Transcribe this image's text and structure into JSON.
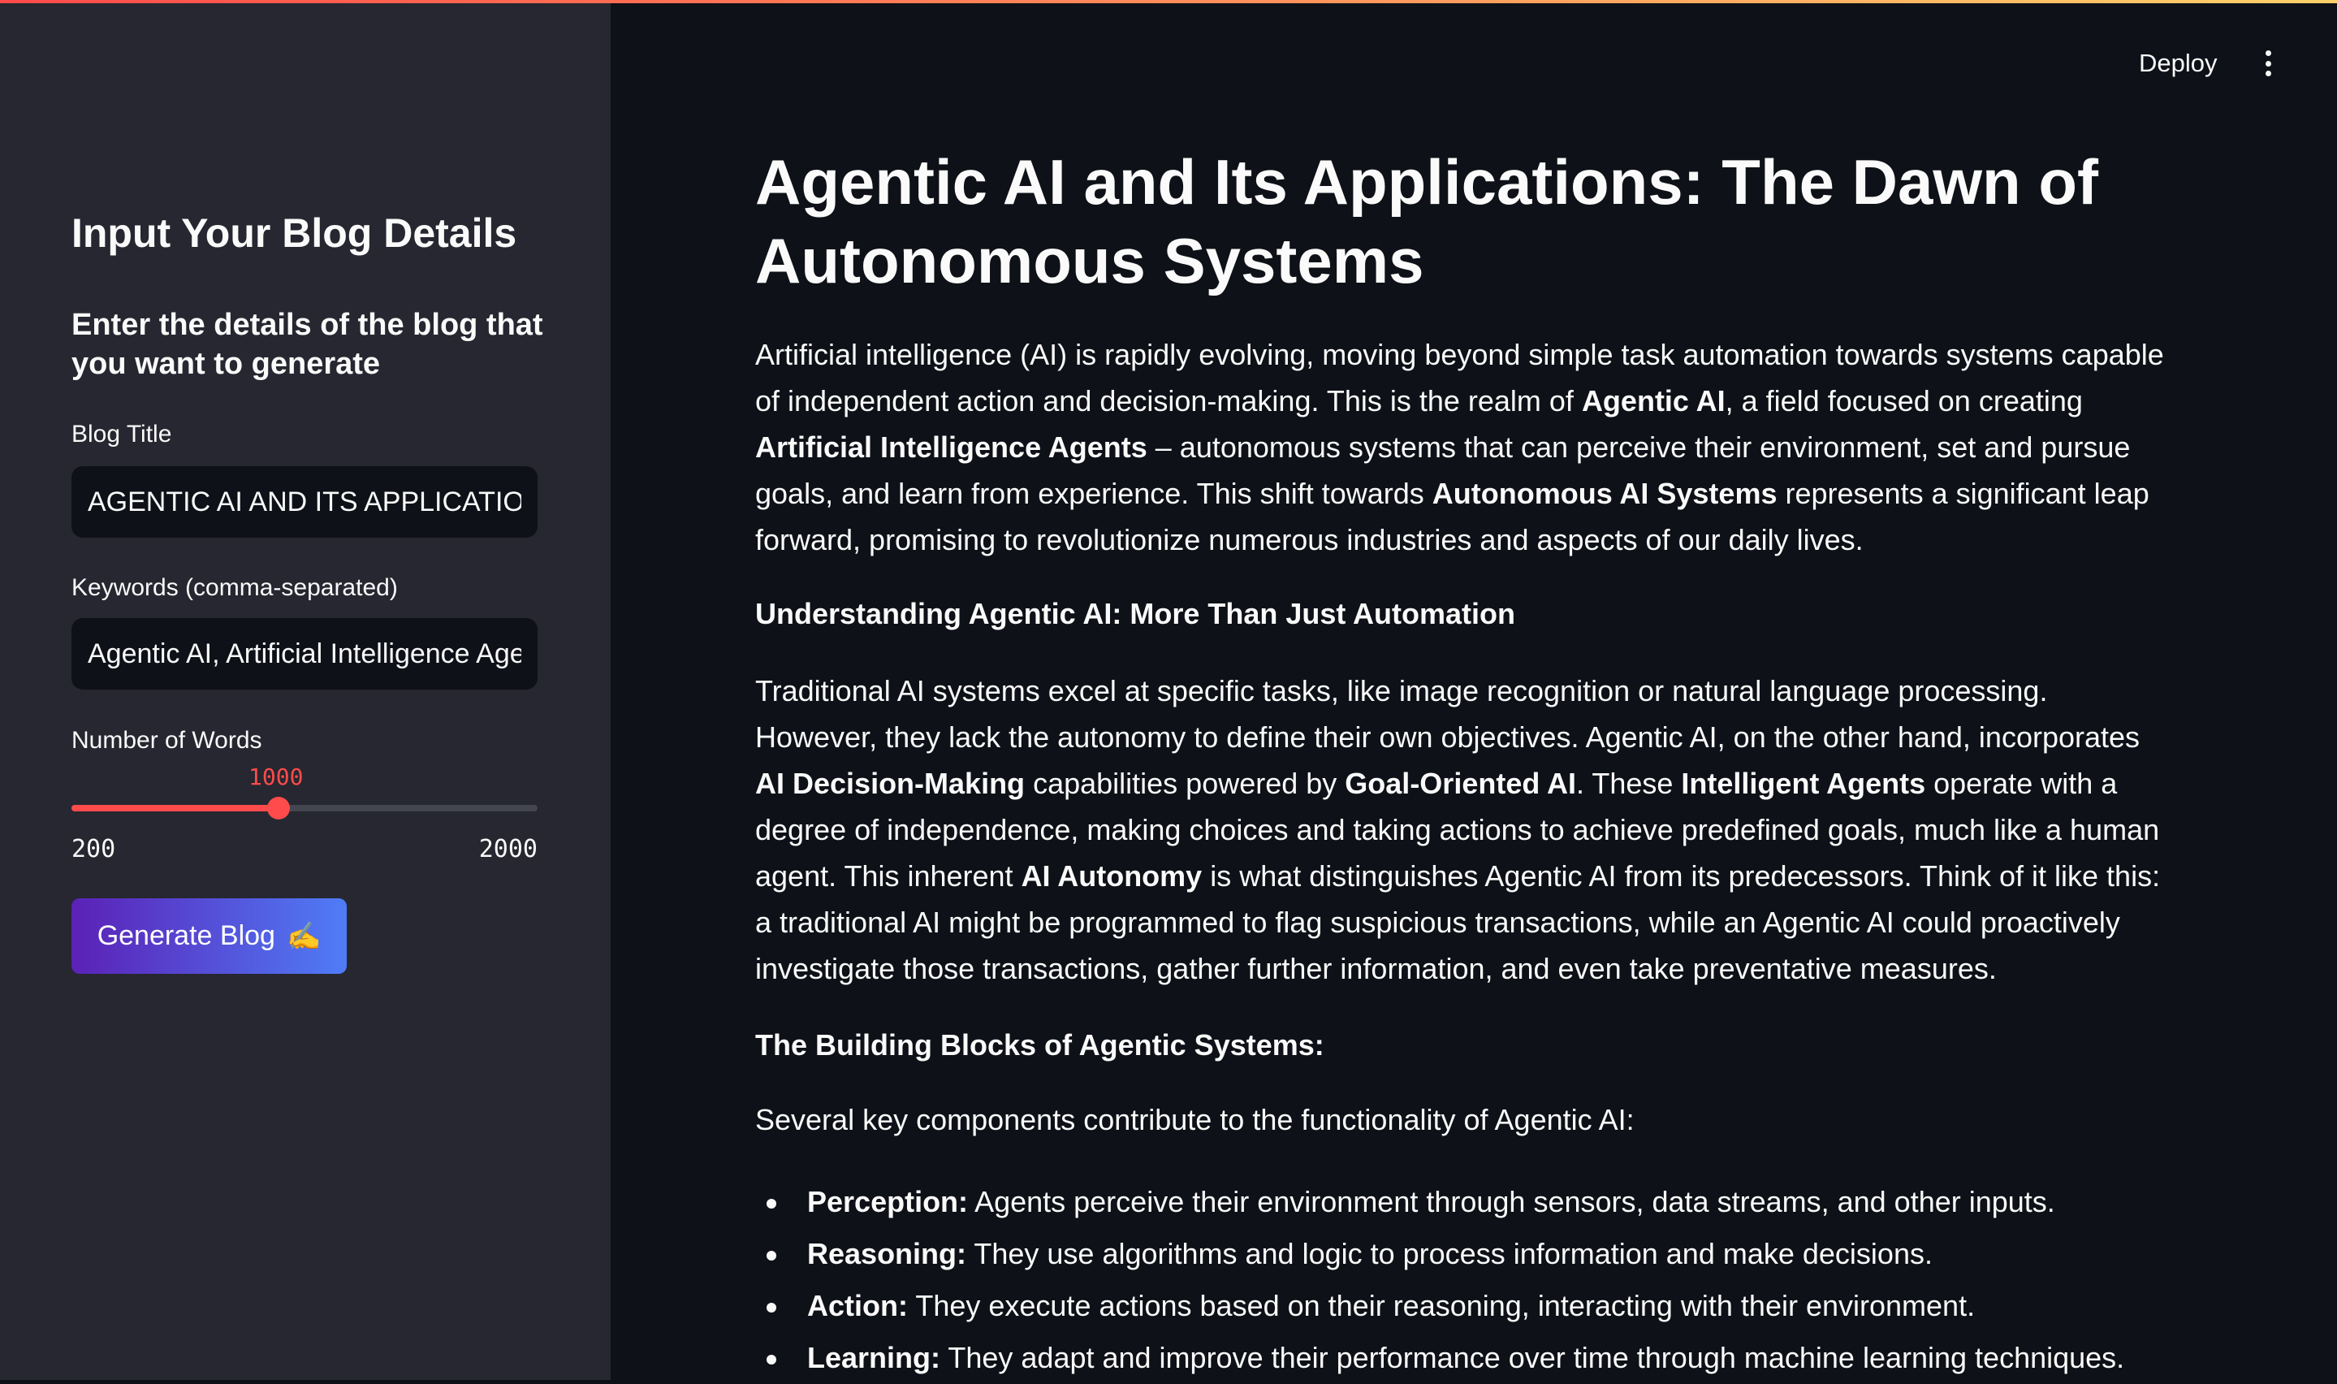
{
  "sidebar": {
    "header": "Input Your Blog Details",
    "subheader": "Enter the details of the blog that you want to generate",
    "title_label": "Blog Title",
    "title_value": "AGENTIC AI AND ITS APPLICATIONS",
    "keywords_label": "Keywords (comma-separated)",
    "keywords_value": "Agentic AI, Artificial Intelligence Age",
    "words_label": "Number of Words",
    "slider": {
      "value": "1000",
      "min": "200",
      "max": "2000",
      "fraction": 0.444
    },
    "accent_color": "#ff4b4b",
    "generate_label": "Generate Blog",
    "generate_emoji": "✍️"
  },
  "toolbar": {
    "deploy_label": "Deploy",
    "menu_icon": "kebab-menu-icon"
  },
  "article": {
    "title": "Agentic AI and Its Applications: The Dawn of Autonomous Systems",
    "intro": {
      "t1": "Artificial intelligence (AI) is rapidly evolving, moving beyond simple task automation towards systems capable of independent action and decision-making. This is the realm of ",
      "b1": "Agentic AI",
      "t2": ", a field focused on creating ",
      "b2": "Artificial Intelligence Agents",
      "t3": " – autonomous systems that can perceive their environment, set and pursue goals, and learn from experience. This shift towards ",
      "b3": "Autonomous AI Systems",
      "t4": " represents a significant leap forward, promising to revolutionize numerous industries and aspects of our daily lives."
    },
    "section1": "Understanding Agentic AI: More Than Just Automation",
    "p2": {
      "t1": "Traditional AI systems excel at specific tasks, like image recognition or natural language processing. However, they lack the autonomy to define their own objectives. Agentic AI, on the other hand, incorporates ",
      "b1": "AI Decision-Making",
      "t2": " capabilities powered by ",
      "b2": "Goal-Oriented AI",
      "t3": ". These ",
      "b3": "Intelligent Agents",
      "t4": " operate with a degree of independence, making choices and taking actions to achieve predefined goals, much like a human agent. This inherent ",
      "b4": "AI Autonomy",
      "t5": " is what distinguishes Agentic AI from its predecessors. Think of it like this: a traditional AI might be programmed to flag suspicious transactions, while an Agentic AI could proactively investigate those transactions, gather further information, and even take preventative measures."
    },
    "section2": "The Building Blocks of Agentic Systems:",
    "p3": "Several key components contribute to the functionality of Agentic AI:",
    "bullets": [
      {
        "term": "Perception:",
        "text": " Agents perceive their environment through sensors, data streams, and other inputs."
      },
      {
        "term": "Reasoning:",
        "text": " They use algorithms and logic to process information and make decisions."
      },
      {
        "term": "Action:",
        "text": " They execute actions based on their reasoning, interacting with their environment."
      },
      {
        "term": "Learning:",
        "text": " They adapt and improve their performance over time through machine learning techniques."
      }
    ]
  }
}
